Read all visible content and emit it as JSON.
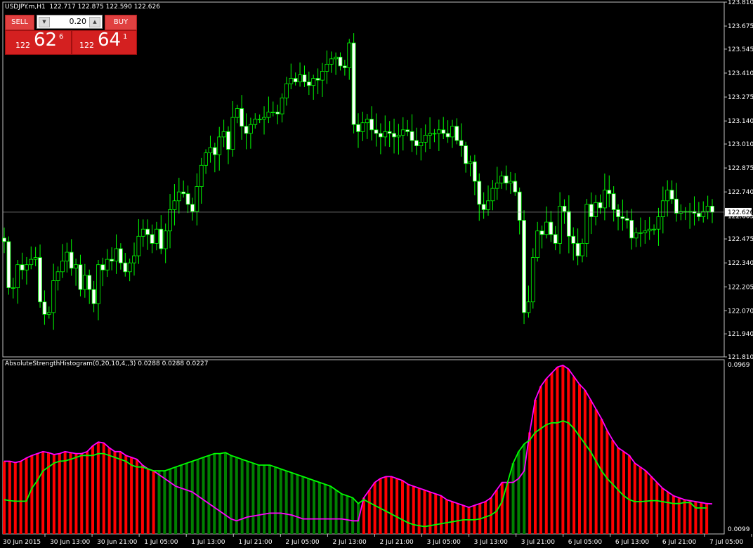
{
  "price_panel": {
    "title": "USDJPY.m,H1  122.717 122.875 122.590 122.626",
    "current_price_label": "122.626"
  },
  "indicator_panel": {
    "title": "AbsoluteStrengthHistogram(0,20,10,4,,3) 0.0288 0.0288 0.0227",
    "max_label": "0.0969",
    "min_label": "0.0099"
  },
  "trade_panel": {
    "sell_label": "SELL",
    "buy_label": "BUY",
    "lot_value": "0.20",
    "sell_price": {
      "small": "122",
      "big": "62",
      "sup": "6"
    },
    "buy_price": {
      "small": "122",
      "big": "64",
      "sup": "1"
    }
  },
  "colors": {
    "background": "#000000",
    "bull_candle": "#ffffff",
    "bear_candle": "#00ff00",
    "hist_red": "#ff0000",
    "hist_green": "#008000",
    "line_magenta": "#ff00ff",
    "line_green": "#00ff00",
    "grid_border": "#c0c0c0"
  },
  "chart_data": [
    {
      "type": "candlestick",
      "symbol": "USDJPY.m",
      "timeframe": "H1",
      "y_ticks": [
        "123.810",
        "123.675",
        "123.545",
        "123.410",
        "123.275",
        "123.140",
        "123.010",
        "122.875",
        "122.740",
        "122.605",
        "122.475",
        "122.340",
        "122.205",
        "122.070",
        "121.940",
        "121.810"
      ],
      "ylim": [
        121.81,
        123.81
      ],
      "x_ticks": [
        "30 Jun 2015",
        "30 Jun 13:00",
        "30 Jun 21:00",
        "1 Jul 05:00",
        "1 Jul 13:00",
        "1 Jul 21:00",
        "2 Jul 05:00",
        "2 Jul 13:00",
        "2 Jul 21:00",
        "3 Jul 05:00",
        "3 Jul 13:00",
        "3 Jul 21:00",
        "6 Jul 05:00",
        "6 Jul 13:00",
        "6 Jul 21:00",
        "7 Jul 05:00"
      ],
      "current_price": 122.626,
      "closes": [
        122.46,
        122.2,
        122.2,
        122.33,
        122.3,
        122.33,
        122.36,
        122.37,
        122.12,
        122.05,
        122.06,
        122.24,
        122.29,
        122.35,
        122.4,
        122.31,
        122.33,
        122.19,
        122.27,
        122.19,
        122.11,
        122.33,
        122.3,
        122.36,
        122.35,
        122.42,
        122.34,
        122.29,
        122.34,
        122.38,
        122.49,
        122.53,
        122.5,
        122.45,
        122.53,
        122.42,
        122.52,
        122.64,
        122.69,
        122.74,
        122.73,
        122.67,
        122.63,
        122.77,
        122.89,
        122.96,
        122.99,
        122.95,
        123.05,
        123.08,
        122.98,
        123.16,
        123.21,
        123.11,
        123.07,
        123.12,
        123.15,
        123.15,
        123.16,
        123.19,
        123.19,
        123.18,
        123.27,
        123.35,
        123.38,
        123.36,
        123.4,
        123.36,
        123.34,
        123.38,
        123.37,
        123.42,
        123.46,
        123.49,
        123.5,
        123.45,
        123.44,
        123.58,
        123.12,
        123.08,
        123.13,
        123.15,
        123.09,
        123.07,
        123.05,
        123.08,
        123.07,
        123.05,
        123.06,
        123.09,
        123.08,
        123.03,
        123.0,
        123.02,
        123.06,
        123.07,
        123.07,
        123.09,
        123.07,
        123.05,
        123.11,
        123.03,
        123.0,
        122.9,
        122.91,
        122.8,
        122.67,
        122.64,
        122.69,
        122.76,
        122.79,
        122.83,
        122.79,
        122.8,
        122.74,
        122.58,
        122.06,
        122.12,
        122.37,
        122.52,
        122.5,
        122.57,
        122.5,
        122.45,
        122.66,
        122.63,
        122.49,
        122.45,
        122.38,
        122.45,
        122.67,
        122.6,
        122.68,
        122.65,
        122.75,
        122.73,
        122.64,
        122.6,
        122.59,
        122.58,
        122.48,
        122.51,
        122.51,
        122.52,
        122.53,
        122.53,
        122.6,
        122.69,
        122.75,
        122.7,
        122.62,
        122.63,
        122.63,
        122.63,
        122.62,
        122.6,
        122.63,
        122.66,
        122.626
      ]
    },
    {
      "type": "histogram",
      "name": "AbsoluteStrengthHistogram(0,20,10,4,,3)",
      "params": [
        0,
        20,
        10,
        4,
        null,
        3
      ],
      "current_values": [
        0.0288,
        0.0288,
        0.0227
      ],
      "ylim": [
        0.0099,
        0.0969
      ],
      "bull_values": [
        0.047,
        0.047,
        0.0463,
        0.047,
        0.0487,
        0.05,
        0.051,
        0.052,
        0.0515,
        0.0505,
        0.051,
        0.052,
        0.0515,
        0.051,
        0.051,
        0.052,
        0.055,
        0.057,
        0.0565,
        0.054,
        0.052,
        0.052,
        0.05,
        0.049,
        0.048,
        0.045,
        0.043,
        0.042,
        0.04,
        0.038,
        0.036,
        0.034,
        0.033,
        0.032,
        0.031,
        0.029,
        0.027,
        0.025,
        0.023,
        0.021,
        0.019,
        0.017,
        0.016,
        0.017,
        0.018,
        0.0185,
        0.019,
        0.0195,
        0.02,
        0.02,
        0.02,
        0.0195,
        0.019,
        0.018,
        0.017,
        0.017,
        0.017,
        0.017,
        0.017,
        0.017,
        0.017,
        0.017,
        0.0165,
        0.016,
        0.016,
        0.028,
        0.032,
        0.036,
        0.038,
        0.039,
        0.039,
        0.038,
        0.037,
        0.035,
        0.034,
        0.033,
        0.032,
        0.031,
        0.03,
        0.029,
        0.027,
        0.026,
        0.025,
        0.024,
        0.023,
        0.024,
        0.025,
        0.026,
        0.028,
        0.032,
        0.036,
        0.036,
        0.036,
        0.038,
        0.042,
        0.062,
        0.079,
        0.086,
        0.09,
        0.093,
        0.096,
        0.0969,
        0.095,
        0.091,
        0.087,
        0.084,
        0.079,
        0.074,
        0.069,
        0.063,
        0.058,
        0.054,
        0.052,
        0.05,
        0.046,
        0.044,
        0.042,
        0.039,
        0.036,
        0.033,
        0.031,
        0.029,
        0.028,
        0.027,
        0.0265,
        0.026,
        0.0255,
        0.025,
        0.0248
      ],
      "bear_values": [
        0.027,
        0.0265,
        0.0262,
        0.0262,
        0.0262,
        0.033,
        0.037,
        0.042,
        0.044,
        0.046,
        0.047,
        0.0472,
        0.048,
        0.049,
        0.05,
        0.05,
        0.05,
        0.051,
        0.051,
        0.05,
        0.049,
        0.048,
        0.047,
        0.045,
        0.044,
        0.044,
        0.043,
        0.042,
        0.042,
        0.042,
        0.043,
        0.044,
        0.045,
        0.046,
        0.047,
        0.048,
        0.049,
        0.05,
        0.051,
        0.051,
        0.0515,
        0.05,
        0.049,
        0.048,
        0.047,
        0.046,
        0.045,
        0.045,
        0.045,
        0.044,
        0.043,
        0.042,
        0.041,
        0.04,
        0.039,
        0.038,
        0.037,
        0.036,
        0.035,
        0.034,
        0.032,
        0.03,
        0.029,
        0.028,
        0.025,
        0.027,
        0.0255,
        0.024,
        0.0225,
        0.021,
        0.0195,
        0.018,
        0.0165,
        0.015,
        0.014,
        0.0135,
        0.013,
        0.0135,
        0.014,
        0.0145,
        0.015,
        0.0155,
        0.016,
        0.0165,
        0.0165,
        0.0165,
        0.017,
        0.018,
        0.019,
        0.021,
        0.026,
        0.036,
        0.046,
        0.052,
        0.056,
        0.058,
        0.062,
        0.064,
        0.066,
        0.067,
        0.067,
        0.068,
        0.067,
        0.064,
        0.06,
        0.056,
        0.052,
        0.047,
        0.042,
        0.038,
        0.035,
        0.032,
        0.029,
        0.027,
        0.026,
        0.026,
        0.0262,
        0.0265,
        0.0265,
        0.026,
        0.0255,
        0.025,
        0.025,
        0.0255,
        0.0255,
        0.0227,
        0.0227,
        0.0227
      ]
    }
  ]
}
